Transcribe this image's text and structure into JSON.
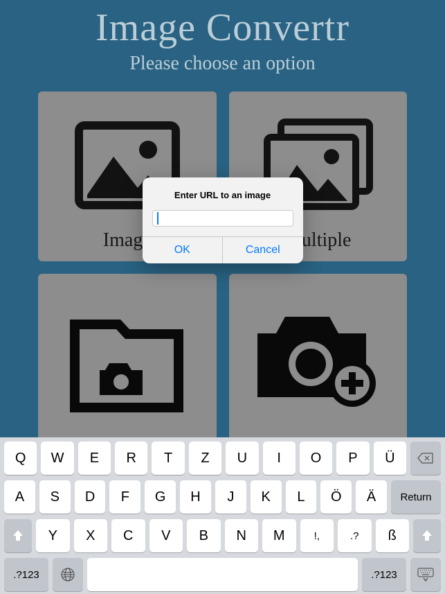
{
  "header": {
    "title": "Image Convertr",
    "subtitle": "Please choose an option"
  },
  "tiles": {
    "image": "Image",
    "multiple": "Multiple"
  },
  "alert": {
    "title": "Enter URL to an image",
    "ok": "OK",
    "cancel": "Cancel",
    "input_value": ""
  },
  "keyboard": {
    "row1": [
      "Q",
      "W",
      "E",
      "R",
      "T",
      "Z",
      "U",
      "I",
      "O",
      "P",
      "Ü"
    ],
    "row2": [
      "A",
      "S",
      "D",
      "F",
      "G",
      "H",
      "J",
      "K",
      "L",
      "Ö",
      "Ä"
    ],
    "row3": [
      "Y",
      "X",
      "C",
      "V",
      "B",
      "N",
      "M",
      "!,",
      ".?",
      "ß"
    ],
    "return": "Return",
    "modechange": ".?123"
  }
}
